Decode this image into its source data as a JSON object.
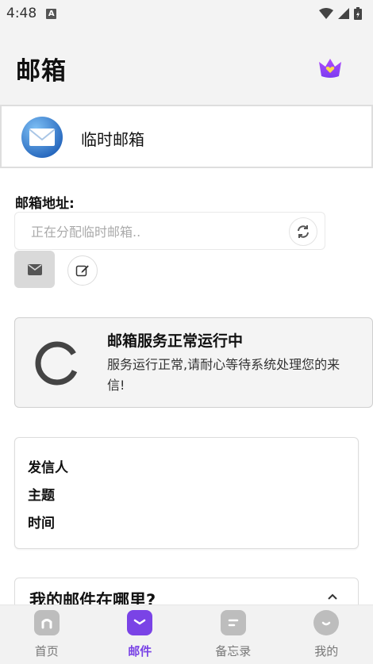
{
  "status_bar": {
    "time": "4:48",
    "notification_icon": "a-icon",
    "icons": [
      "wifi-icon",
      "signal-icon",
      "battery-icon"
    ]
  },
  "header": {
    "title": "邮箱",
    "crown_icon": "crown-heart-icon",
    "accent": "#8b3bf5"
  },
  "mailbox": {
    "name": "临时邮箱",
    "avatar_icon": "envelope-icon"
  },
  "address": {
    "label": "邮箱地址:",
    "placeholder": "正在分配临时邮箱..",
    "value": "",
    "refresh_icon": "refresh-icon",
    "mail_icon": "mail-icon",
    "edit_icon": "edit-icon"
  },
  "service": {
    "title": "邮箱服务正常运行中",
    "desc": "服务运行正常,请耐心等待系统处理您的来信!",
    "icon": "loading-spinner-icon"
  },
  "mail_detail": {
    "sender_label": "发信人",
    "subject_label": "主题",
    "time_label": "时间"
  },
  "faq": {
    "title": "我的邮件在哪里?",
    "icon": "chevron-icon"
  },
  "bottom_nav": {
    "items": [
      {
        "label": "首页",
        "icon": "home-icon",
        "active": false
      },
      {
        "label": "邮件",
        "icon": "mail-icon",
        "active": true
      },
      {
        "label": "备忘录",
        "icon": "notes-icon",
        "active": false
      },
      {
        "label": "我的",
        "icon": "profile-icon",
        "active": false
      }
    ],
    "active_color": "#7a43e6",
    "inactive_color": "#bdbdbd"
  }
}
